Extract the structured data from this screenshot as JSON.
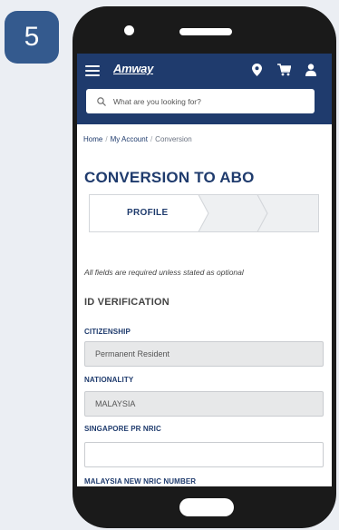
{
  "step_number": "5",
  "colors": {
    "brand_blue": "#1f3b6d",
    "badge_blue": "#345a8e",
    "page_bg": "#ebeef3",
    "field_readonly_bg": "#e7e8e9"
  },
  "header": {
    "brand": "Amway",
    "icons": [
      "location-pin-icon",
      "cart-icon",
      "user-icon"
    ]
  },
  "search": {
    "placeholder": "What are you looking for?"
  },
  "breadcrumb": {
    "items": [
      "Home",
      "My Account",
      "Conversion"
    ],
    "separator": "/"
  },
  "page": {
    "title": "CONVERSION TO ABO"
  },
  "stepper": {
    "active_step": "PROFILE"
  },
  "form": {
    "hint": "All fields are required unless stated as optional",
    "section_title": "ID VERIFICATION",
    "citizenship": {
      "label": "CITIZENSHIP",
      "value": "Permanent Resident"
    },
    "nationality": {
      "label": "NATIONALITY",
      "value": "MALAYSIA"
    },
    "sg_pr_nric": {
      "label": "SINGAPORE PR NRIC",
      "value": ""
    },
    "my_new_nric": {
      "label": "MALAYSIA NEW NRIC NUMBER"
    }
  }
}
